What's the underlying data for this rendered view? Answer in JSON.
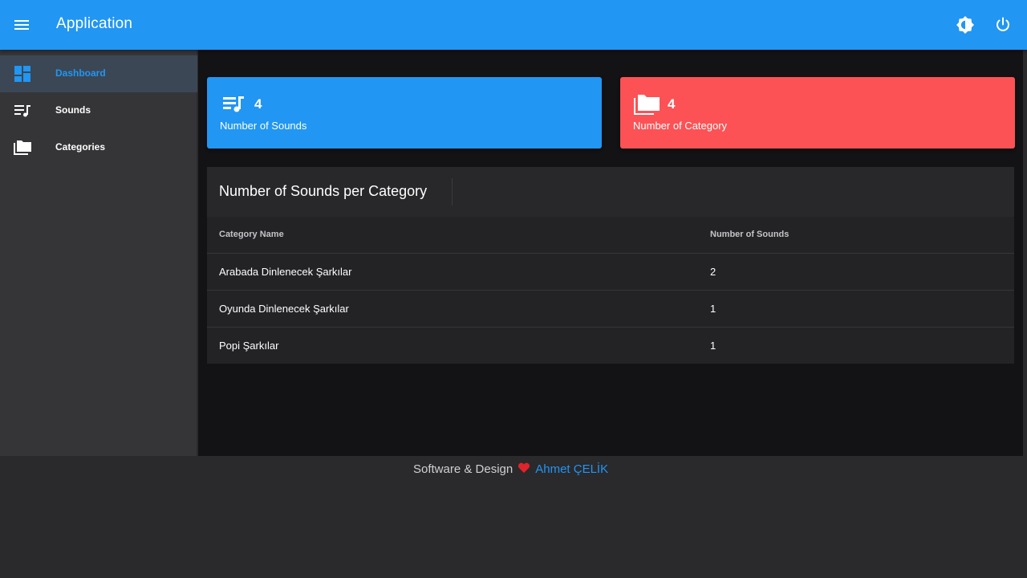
{
  "appbar": {
    "title": "Application",
    "menu_icon": "menu-icon",
    "theme_icon": "brightness-icon",
    "power_icon": "power-icon"
  },
  "sidebar": {
    "items": [
      {
        "label": "Dashboard",
        "icon": "dashboard-icon",
        "active": true
      },
      {
        "label": "Sounds",
        "icon": "playlist-music-icon",
        "active": false
      },
      {
        "label": "Categories",
        "icon": "folders-icon",
        "active": false
      }
    ]
  },
  "stats": [
    {
      "value": "4",
      "label": "Number of Sounds",
      "icon": "playlist-music-icon",
      "color": "#2196f3"
    },
    {
      "value": "4",
      "label": "Number of Category",
      "icon": "folders-icon",
      "color": "#fc5255"
    }
  ],
  "table": {
    "title": "Number of Sounds per Category",
    "columns": [
      "Category Name",
      "Number of Sounds"
    ],
    "rows": [
      [
        "Arabada Dinlenecek Şarkılar",
        "2"
      ],
      [
        "Oyunda Dinlenecek Şarkılar",
        "1"
      ],
      [
        "Popi Şarkılar",
        "1"
      ]
    ]
  },
  "footer": {
    "text": "Software & Design",
    "heart_icon": "heart-icon",
    "author": "Ahmet ÇELİK"
  },
  "colors": {
    "primary": "#2196f3",
    "danger": "#fc5255",
    "background": "#131214",
    "sidebar": "#353538"
  }
}
